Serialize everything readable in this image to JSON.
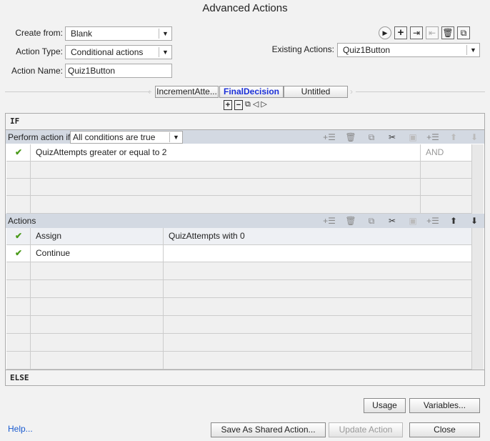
{
  "title": "Advanced Actions",
  "form": {
    "create_from_label": "Create from:",
    "create_from_value": "Blank",
    "action_type_label": "Action Type:",
    "action_type_value": "Conditional actions",
    "action_name_label": "Action Name:",
    "action_name_value": "Quiz1Button",
    "existing_label": "Existing Actions:",
    "existing_value": "Quiz1Button"
  },
  "toolbar_icons": [
    "preview-icon",
    "add-icon",
    "import-icon",
    "export-icon",
    "delete-icon",
    "duplicate-icon"
  ],
  "tabs": [
    {
      "label": "IncrementAtte..."
    },
    {
      "label": "FinalDecision",
      "active": true
    },
    {
      "label": "Untitled"
    }
  ],
  "if_label": "IF",
  "else_label": "ELSE",
  "conditions": {
    "perform_label": "Perform action if:",
    "mode": "All conditions are true",
    "rows": [
      {
        "checked": true,
        "text": "QuizAttempts   greater or equal to   2",
        "op": "AND"
      }
    ]
  },
  "actions": {
    "label": "Actions",
    "rows": [
      {
        "checked": true,
        "action": "Assign",
        "param": "QuizAttempts    with    0"
      },
      {
        "checked": true,
        "action": "Continue",
        "param": ""
      }
    ]
  },
  "buttons": {
    "usage": "Usage",
    "variables": "Variables...",
    "help": "Help...",
    "save_shared": "Save As Shared Action...",
    "update": "Update Action",
    "close": "Close"
  },
  "check_glyph": "✔"
}
